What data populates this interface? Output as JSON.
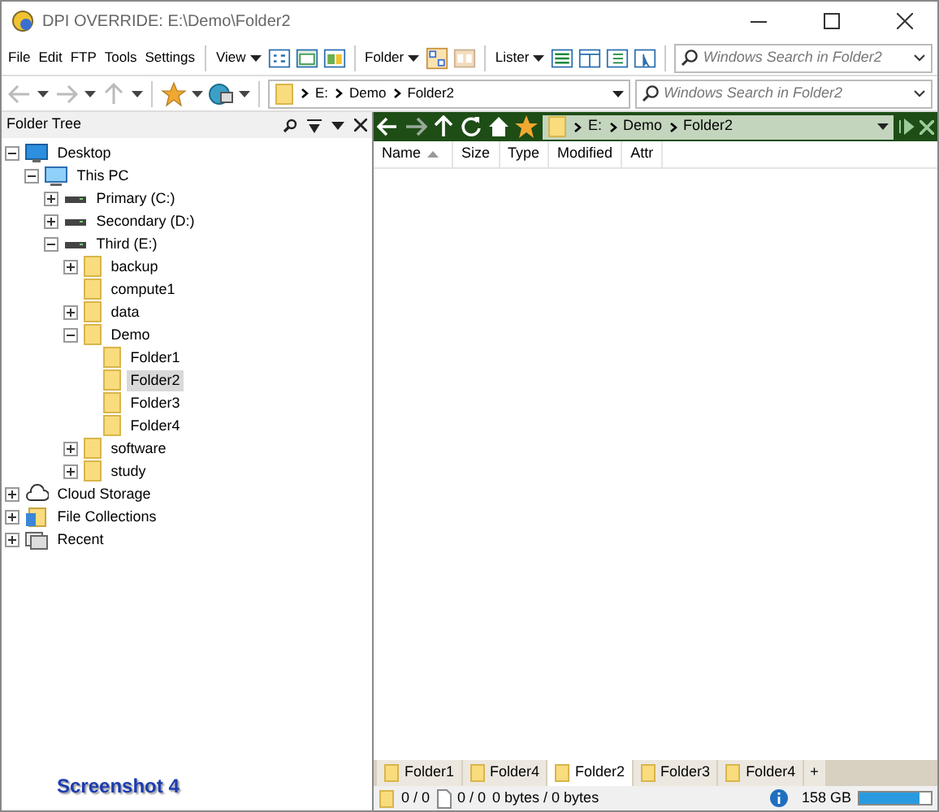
{
  "window": {
    "title": "DPI OVERRIDE: E:\\Demo\\Folder2"
  },
  "toolbar": {
    "menus": [
      "File",
      "Edit",
      "FTP",
      "Tools",
      "Settings"
    ],
    "dropdowns": [
      "View",
      "Folder",
      "Lister"
    ],
    "search": {
      "placeholder": "Windows Search in Folder2"
    }
  },
  "navbar": {
    "path": [
      "E:",
      "Demo",
      "Folder2"
    ],
    "search": {
      "placeholder": "Windows Search in Folder2"
    }
  },
  "folder_tree": {
    "title": "Folder Tree",
    "items": [
      {
        "label": "Desktop",
        "kind": "desktop",
        "expanded": true,
        "selected": false,
        "children": [
          {
            "label": "This PC",
            "kind": "pc",
            "expanded": true,
            "selected": false,
            "children": [
              {
                "label": "Primary (C:)",
                "kind": "drive",
                "expanded": false,
                "selected": false
              },
              {
                "label": "Secondary (D:)",
                "kind": "drive",
                "expanded": false,
                "selected": false
              },
              {
                "label": "Third (E:)",
                "kind": "drive",
                "expanded": true,
                "selected": false,
                "children": [
                  {
                    "label": "backup",
                    "kind": "folder",
                    "expanded": false,
                    "selected": false
                  },
                  {
                    "label": "compute1",
                    "kind": "folder",
                    "selected": false
                  },
                  {
                    "label": "data",
                    "kind": "folder",
                    "expanded": false,
                    "selected": false
                  },
                  {
                    "label": "Demo",
                    "kind": "folder",
                    "expanded": true,
                    "selected": false,
                    "children": [
                      {
                        "label": "Folder1",
                        "kind": "folder",
                        "selected": false
                      },
                      {
                        "label": "Folder2",
                        "kind": "folder",
                        "selected": true
                      },
                      {
                        "label": "Folder3",
                        "kind": "folder",
                        "selected": false
                      },
                      {
                        "label": "Folder4",
                        "kind": "folder",
                        "selected": false
                      }
                    ]
                  },
                  {
                    "label": "software",
                    "kind": "folder",
                    "expanded": false,
                    "selected": false
                  },
                  {
                    "label": "study",
                    "kind": "folder",
                    "expanded": false,
                    "selected": false
                  }
                ]
              }
            ]
          }
        ]
      },
      {
        "label": "Cloud Storage",
        "kind": "cloud",
        "expanded": false,
        "selected": false
      },
      {
        "label": "File Collections",
        "kind": "collections",
        "expanded": false,
        "selected": false
      },
      {
        "label": "Recent",
        "kind": "recent",
        "expanded": false,
        "selected": false
      }
    ]
  },
  "lister": {
    "path": [
      "E:",
      "Demo",
      "Folder2"
    ],
    "columns": [
      {
        "label": "Name",
        "sorted_ascending": true
      },
      {
        "label": "Size"
      },
      {
        "label": "Type"
      },
      {
        "label": "Modified"
      },
      {
        "label": "Attr"
      }
    ]
  },
  "tabs": [
    {
      "label": "Folder1",
      "selected": false
    },
    {
      "label": "Folder4",
      "selected": false
    },
    {
      "label": "Folder2",
      "selected": true
    },
    {
      "label": "Folder3",
      "selected": false
    },
    {
      "label": "Folder4",
      "selected": false
    }
  ],
  "new_tab": "+",
  "caption": "Screenshot 4",
  "status_bar": {
    "folders": "0 / 0",
    "files": "0 / 0",
    "size": "0 bytes / 0 bytes",
    "free": "158 GB",
    "disk": {
      "level": 0.85
    }
  }
}
